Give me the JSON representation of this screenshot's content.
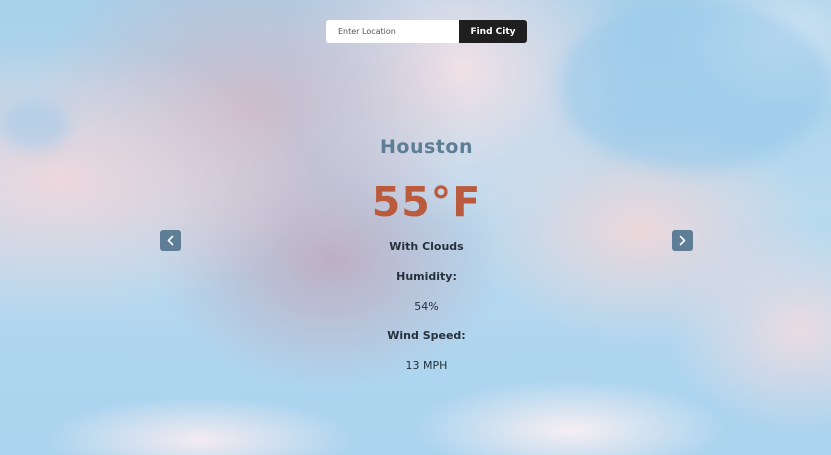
{
  "search": {
    "placeholder": "Enter Location",
    "button_label": "Find City"
  },
  "weather": {
    "city": "Houston",
    "temperature": "55°F",
    "condition": "With Clouds",
    "humidity_label": "Humidity:",
    "humidity_value": "54%",
    "wind_label": "Wind Speed:",
    "wind_value": "13 MPH"
  },
  "navigation": {
    "prev_icon": "chevron-left-icon",
    "next_icon": "chevron-right-icon"
  },
  "colors": {
    "accent": "#5d7e95",
    "temperature": "#b95b3c",
    "button_bg": "#1f1f1f"
  }
}
